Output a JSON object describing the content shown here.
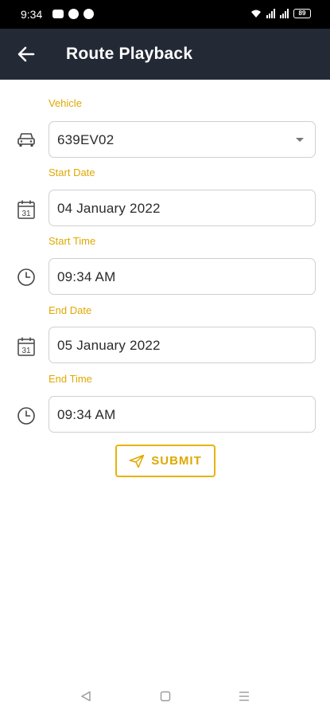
{
  "status_bar": {
    "time": "9:34",
    "battery": "89"
  },
  "app_bar": {
    "title": "Route Playback"
  },
  "form": {
    "vehicle": {
      "label": "Vehicle",
      "value": "639EV02"
    },
    "start_date": {
      "label": "Start Date",
      "value": "04 January 2022",
      "icon_day": "31"
    },
    "start_time": {
      "label": "Start Time",
      "value": "09:34 AM"
    },
    "end_date": {
      "label": "End Date",
      "value": "05 January 2022",
      "icon_day": "31"
    },
    "end_time": {
      "label": "End Time",
      "value": "09:34 AM"
    }
  },
  "submit": {
    "label": "SUBMIT"
  },
  "colors": {
    "accent": "#e0a800",
    "app_bar": "#232935",
    "field_border": "#cfcfcf"
  },
  "icons": {
    "back": "arrow-left-icon",
    "vehicle": "car-icon",
    "date": "calendar-icon",
    "time": "clock-icon",
    "submit": "send-icon",
    "nav_back": "triangle-back-icon",
    "nav_home": "square-home-icon",
    "nav_menu": "menu-lines-icon"
  }
}
